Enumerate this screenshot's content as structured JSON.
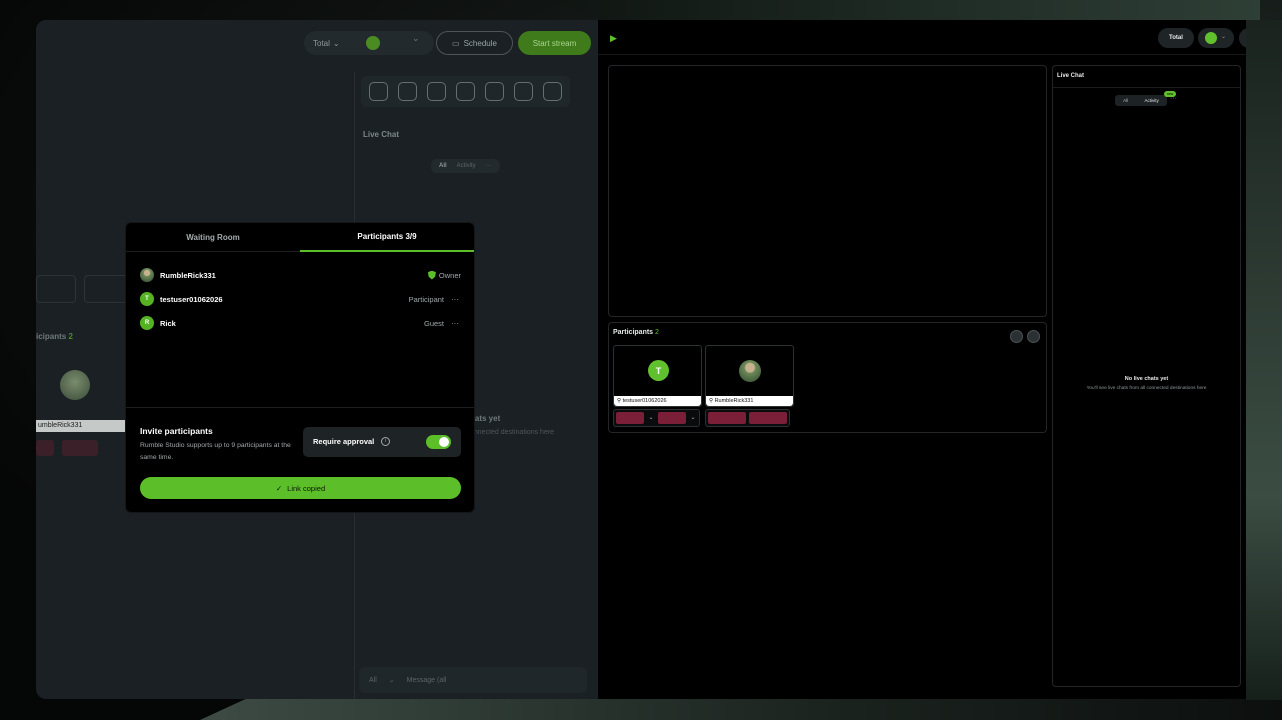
{
  "left_window": {
    "topbar": {
      "total_label": "Total",
      "total_chev": "⌄",
      "dest_chev": "⌄",
      "schedule_label": "Schedule",
      "start_label": "Start stream"
    },
    "chat_title": "Live Chat",
    "chat_seg": {
      "all": "All",
      "activity": "Activity",
      "more": "···"
    },
    "participants_label": "icipants",
    "participants_count": "2",
    "tile_name": "umbleRick331",
    "no_chats_partial": "hats yet",
    "no_chats_sub_partial": "onnected destinations here",
    "message_filter": "All",
    "message_placeholder": "Message (all"
  },
  "right_window": {
    "total_label": "Total",
    "chat_title": "Live Chat",
    "chat_tabs": {
      "all": "All",
      "activity": "Activity",
      "badge": "new",
      "more": "···"
    },
    "empty_title": "No live chats yet",
    "empty_sub": "You'll see live chats from all connected destinations here",
    "participants_title": "Participants",
    "participants_count": "2",
    "tiles": [
      {
        "initial": "T",
        "name": "testuser01062026"
      },
      {
        "initial": "",
        "name": "RumbleRick331"
      }
    ]
  },
  "modal": {
    "tabs": {
      "waiting": "Waiting Room",
      "participants": "Participants  3/9"
    },
    "participants": [
      {
        "initial": "",
        "name": "RumbleRick331",
        "role": "Owner",
        "more": ""
      },
      {
        "initial": "T",
        "name": "testuser01062026",
        "role": "Participant",
        "more": "···"
      },
      {
        "initial": "R",
        "name": "Rick",
        "role": "Guest",
        "more": "···"
      }
    ],
    "invite_title": "Invite participants",
    "invite_sub": "Rumble Studio supports up to 9 participants at the same time.",
    "require_approval_label": "Require approval",
    "require_approval_on": true,
    "copy_button_label": "Link copied"
  },
  "colors": {
    "accent": "#5cbf29",
    "mic_off": "#7a1f37"
  }
}
